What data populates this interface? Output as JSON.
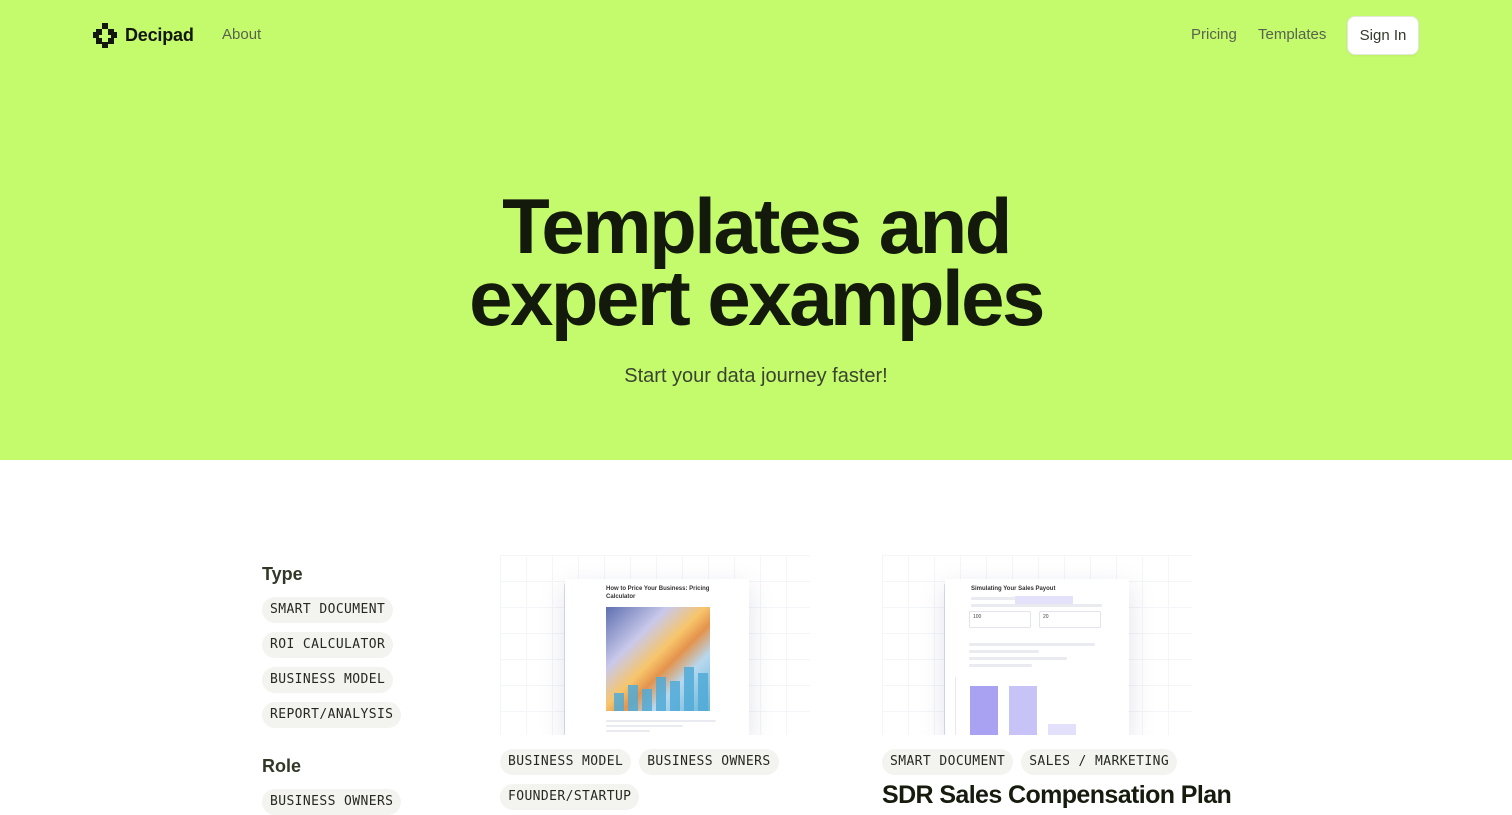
{
  "brand": {
    "name": "Decipad",
    "logo_icon": "decipad-logo-icon"
  },
  "nav": {
    "about": "About",
    "pricing": "Pricing",
    "templates": "Templates",
    "sign_in": "Sign In"
  },
  "hero": {
    "title_line1": "Templates and",
    "title_line2": "expert examples",
    "subtitle": "Start your data journey faster!",
    "background_color": "#c4fb6c"
  },
  "filters": {
    "type": {
      "heading": "Type",
      "options": [
        "SMART DOCUMENT",
        "ROI CALCULATOR",
        "BUSINESS MODEL",
        "REPORT/ANALYSIS"
      ]
    },
    "role": {
      "heading": "Role",
      "options": [
        "BUSINESS OWNERS"
      ]
    }
  },
  "cards": [
    {
      "thumbnail": {
        "doc_title": "How to Price Your Business: Pricing Calculator"
      },
      "tags": [
        "BUSINESS MODEL",
        "BUSINESS OWNERS",
        "FOUNDER/STARTUP"
      ],
      "title": ""
    },
    {
      "thumbnail": {
        "doc_title": "Simulating Your Sales Payout",
        "input_a": "100",
        "input_b": "20"
      },
      "tags": [
        "SMART DOCUMENT",
        "SALES / MARKETING"
      ],
      "title": "SDR Sales Compensation Plan"
    }
  ]
}
